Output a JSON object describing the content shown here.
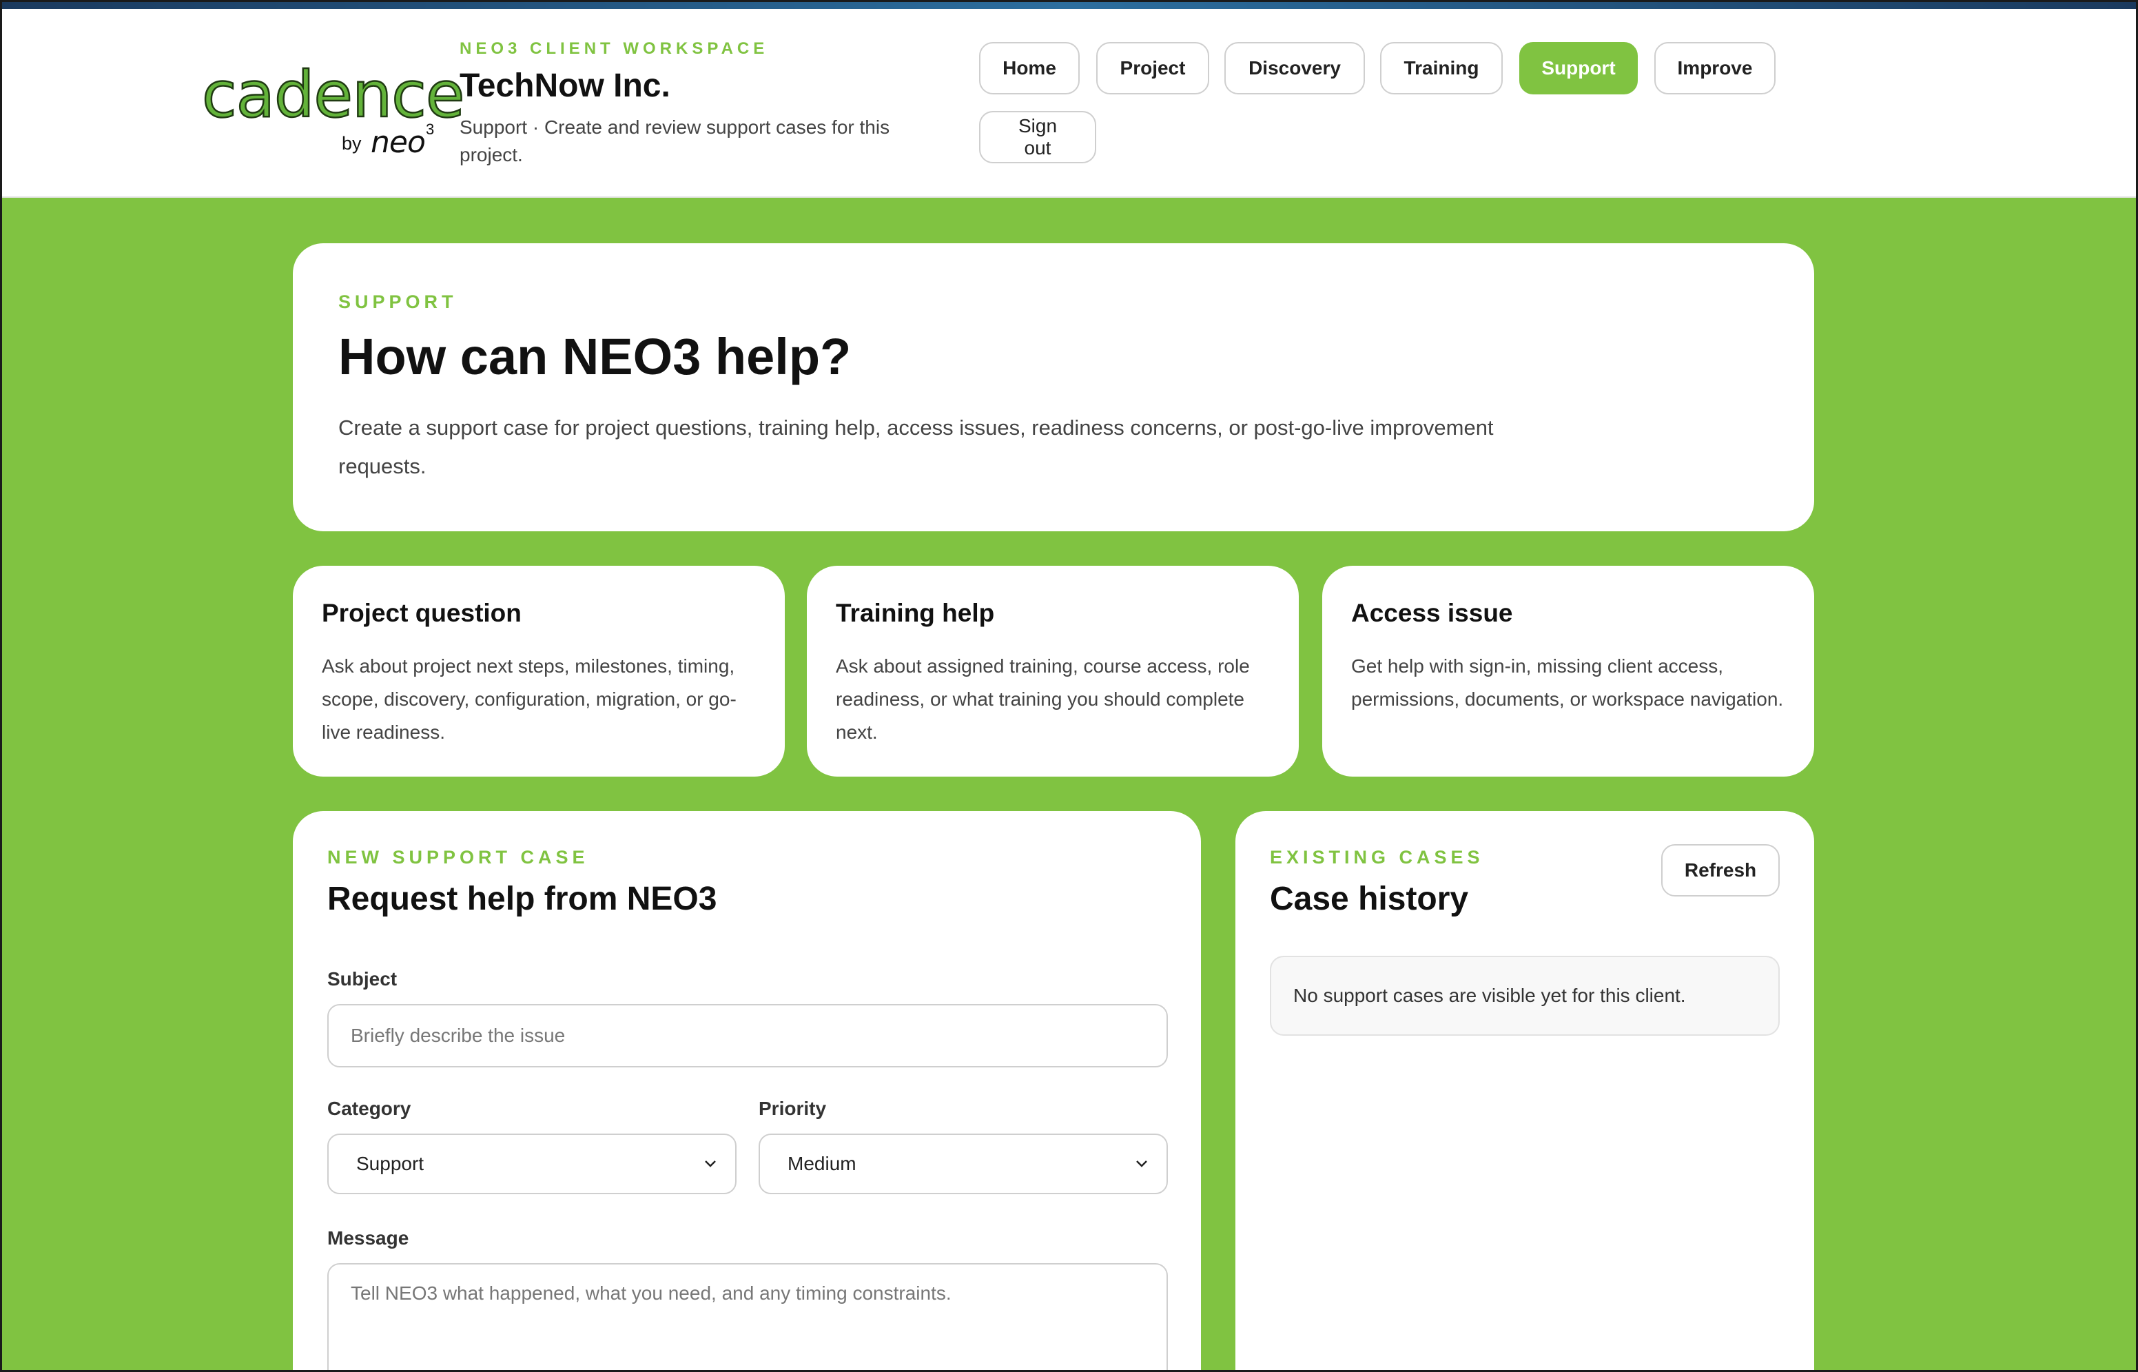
{
  "brand": {
    "word": "cadence",
    "by": "by",
    "neo": "neo",
    "neo_sup": "3"
  },
  "workspace": {
    "eyebrow": "NEO3 CLIENT WORKSPACE",
    "client_name": "TechNow Inc.",
    "subtitle": "Support · Create and review support cases for this project."
  },
  "nav": {
    "items": [
      "Home",
      "Project",
      "Discovery",
      "Training",
      "Support",
      "Improve"
    ],
    "active": "Support",
    "sign_out": "Sign out"
  },
  "hero": {
    "eyebrow": "SUPPORT",
    "title": "How can NEO3 help?",
    "description": "Create a support case for project questions, training help, access issues, readiness concerns, or post-go-live improvement requests."
  },
  "options": [
    {
      "title": "Project question",
      "text": "Ask about project next steps, milestones, timing, scope, discovery, configuration, migration, or go-live readiness."
    },
    {
      "title": "Training help",
      "text": "Ask about assigned training, course access, role readiness, or what training you should complete next."
    },
    {
      "title": "Access issue",
      "text": "Get help with sign-in, missing client access, permissions, documents, or workspace navigation."
    }
  ],
  "new_case": {
    "eyebrow": "NEW SUPPORT CASE",
    "title": "Request help from NEO3",
    "subject_label": "Subject",
    "subject_placeholder": "Briefly describe the issue",
    "category_label": "Category",
    "category_value": "Support",
    "priority_label": "Priority",
    "priority_value": "Medium",
    "message_label": "Message",
    "message_placeholder": "Tell NEO3 what happened, what you need, and any timing constraints."
  },
  "history": {
    "eyebrow": "EXISTING CASES",
    "title": "Case history",
    "refresh_label": "Refresh",
    "empty_text": "No support cases are visible yet for this client."
  },
  "colors": {
    "accent_green": "#80c341",
    "logo_green": "#63b33a",
    "top_strip": "#2c6e9e"
  }
}
